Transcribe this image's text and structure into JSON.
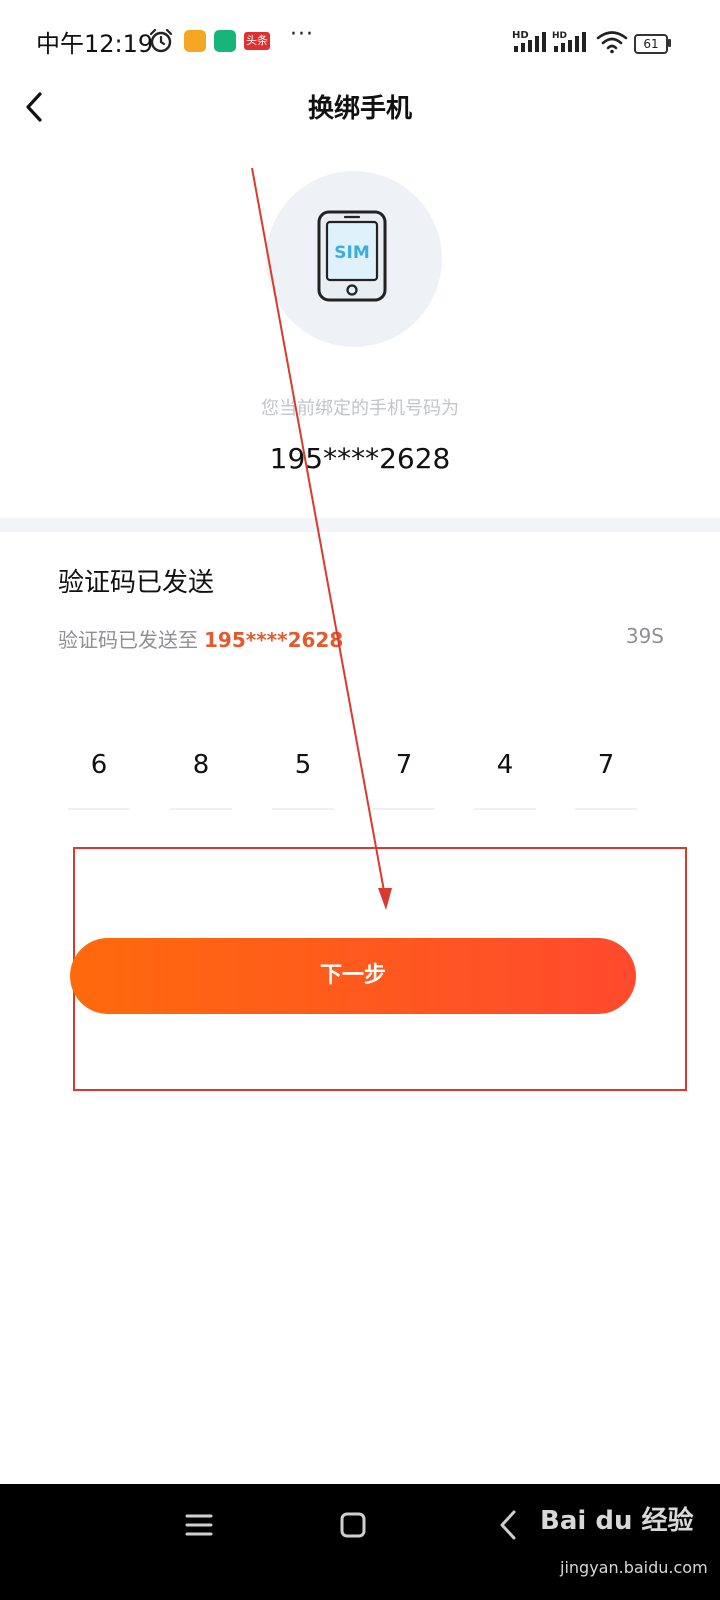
{
  "status_bar": {
    "time": "中午12:19",
    "app_badge": "头条",
    "more": "···",
    "signal_1_label": "HD",
    "signal_2_label": "HD",
    "battery": "61"
  },
  "header": {
    "title": "换绑手机"
  },
  "bound": {
    "label": "您当前绑定的手机号码为",
    "number": "195****2628",
    "sim_text": "SIM"
  },
  "verification": {
    "title": "验证码已发送",
    "sent_prefix": "验证码已发送至",
    "sent_number": "195****2628",
    "countdown": "39S",
    "digits": [
      "6",
      "8",
      "5",
      "7",
      "4",
      "7"
    ]
  },
  "actions": {
    "next_label": "下一步"
  },
  "watermark": {
    "logo": "Bai du 经验",
    "url": "jingyan.baidu.com"
  },
  "colors": {
    "accent": "#ff5a1f",
    "highlight_number": "#e35a2c",
    "annotation": "#d93a2f"
  }
}
